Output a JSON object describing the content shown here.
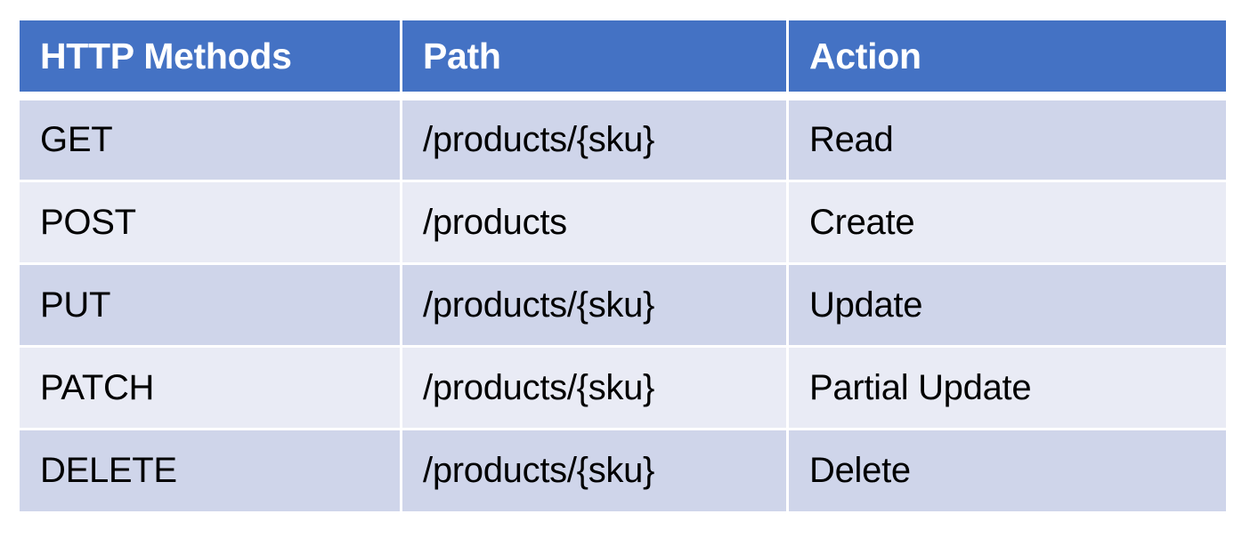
{
  "table": {
    "headers": [
      "HTTP Methods",
      "Path",
      "Action"
    ],
    "rows": [
      [
        "GET",
        "/products/{sku}",
        "Read"
      ],
      [
        "POST",
        "/products",
        "Create"
      ],
      [
        "PUT",
        "/products/{sku}",
        "Update"
      ],
      [
        "PATCH",
        "/products/{sku}",
        "Partial Update"
      ],
      [
        "DELETE",
        "/products/{sku}",
        "Delete"
      ]
    ]
  },
  "colors": {
    "header_bg": "#4472C4",
    "header_text": "#FFFFFF",
    "row_dark": "#CFD5EA",
    "row_light": "#E9EBF5",
    "body_text": "#000000"
  }
}
